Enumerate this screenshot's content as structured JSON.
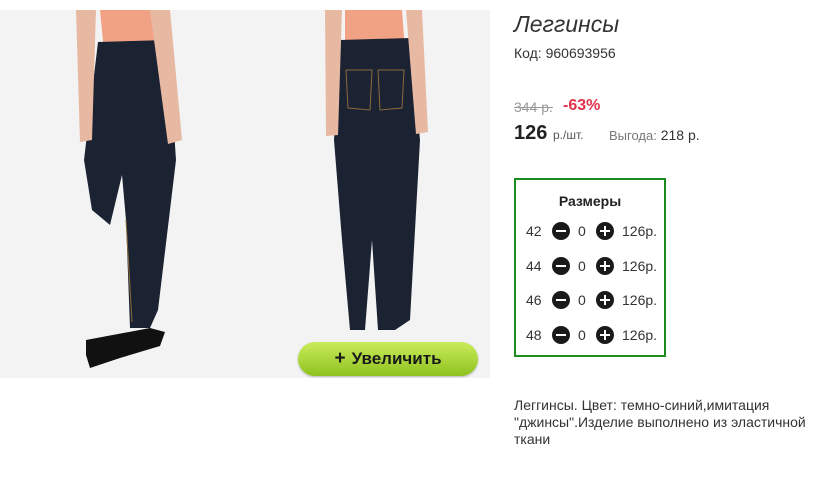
{
  "product": {
    "title": "Леггинсы",
    "code": "Код: 960693956",
    "old_price": "344 р.",
    "discount": "-63%",
    "price": "126",
    "unit": "р./шт.",
    "saving_label": "Выгода:",
    "saving_value": "218 р.",
    "description": "Леггинсы. Цвет: темно-синий,имитация \"джинсы\".Изделие выполнено из эластичной ткани"
  },
  "zoom": {
    "plus": "+",
    "label": "Увеличить"
  },
  "sizes": {
    "title": "Размеры",
    "rows": [
      {
        "size": "42",
        "qty": "0",
        "price": "126р."
      },
      {
        "size": "44",
        "qty": "0",
        "price": "126р."
      },
      {
        "size": "46",
        "qty": "0",
        "price": "126р."
      },
      {
        "size": "48",
        "qty": "0",
        "price": "126р."
      }
    ]
  },
  "colors": {
    "accent_green": "#1e8b1e",
    "discount_red": "#e0314b",
    "button_green": "#9acd32"
  }
}
